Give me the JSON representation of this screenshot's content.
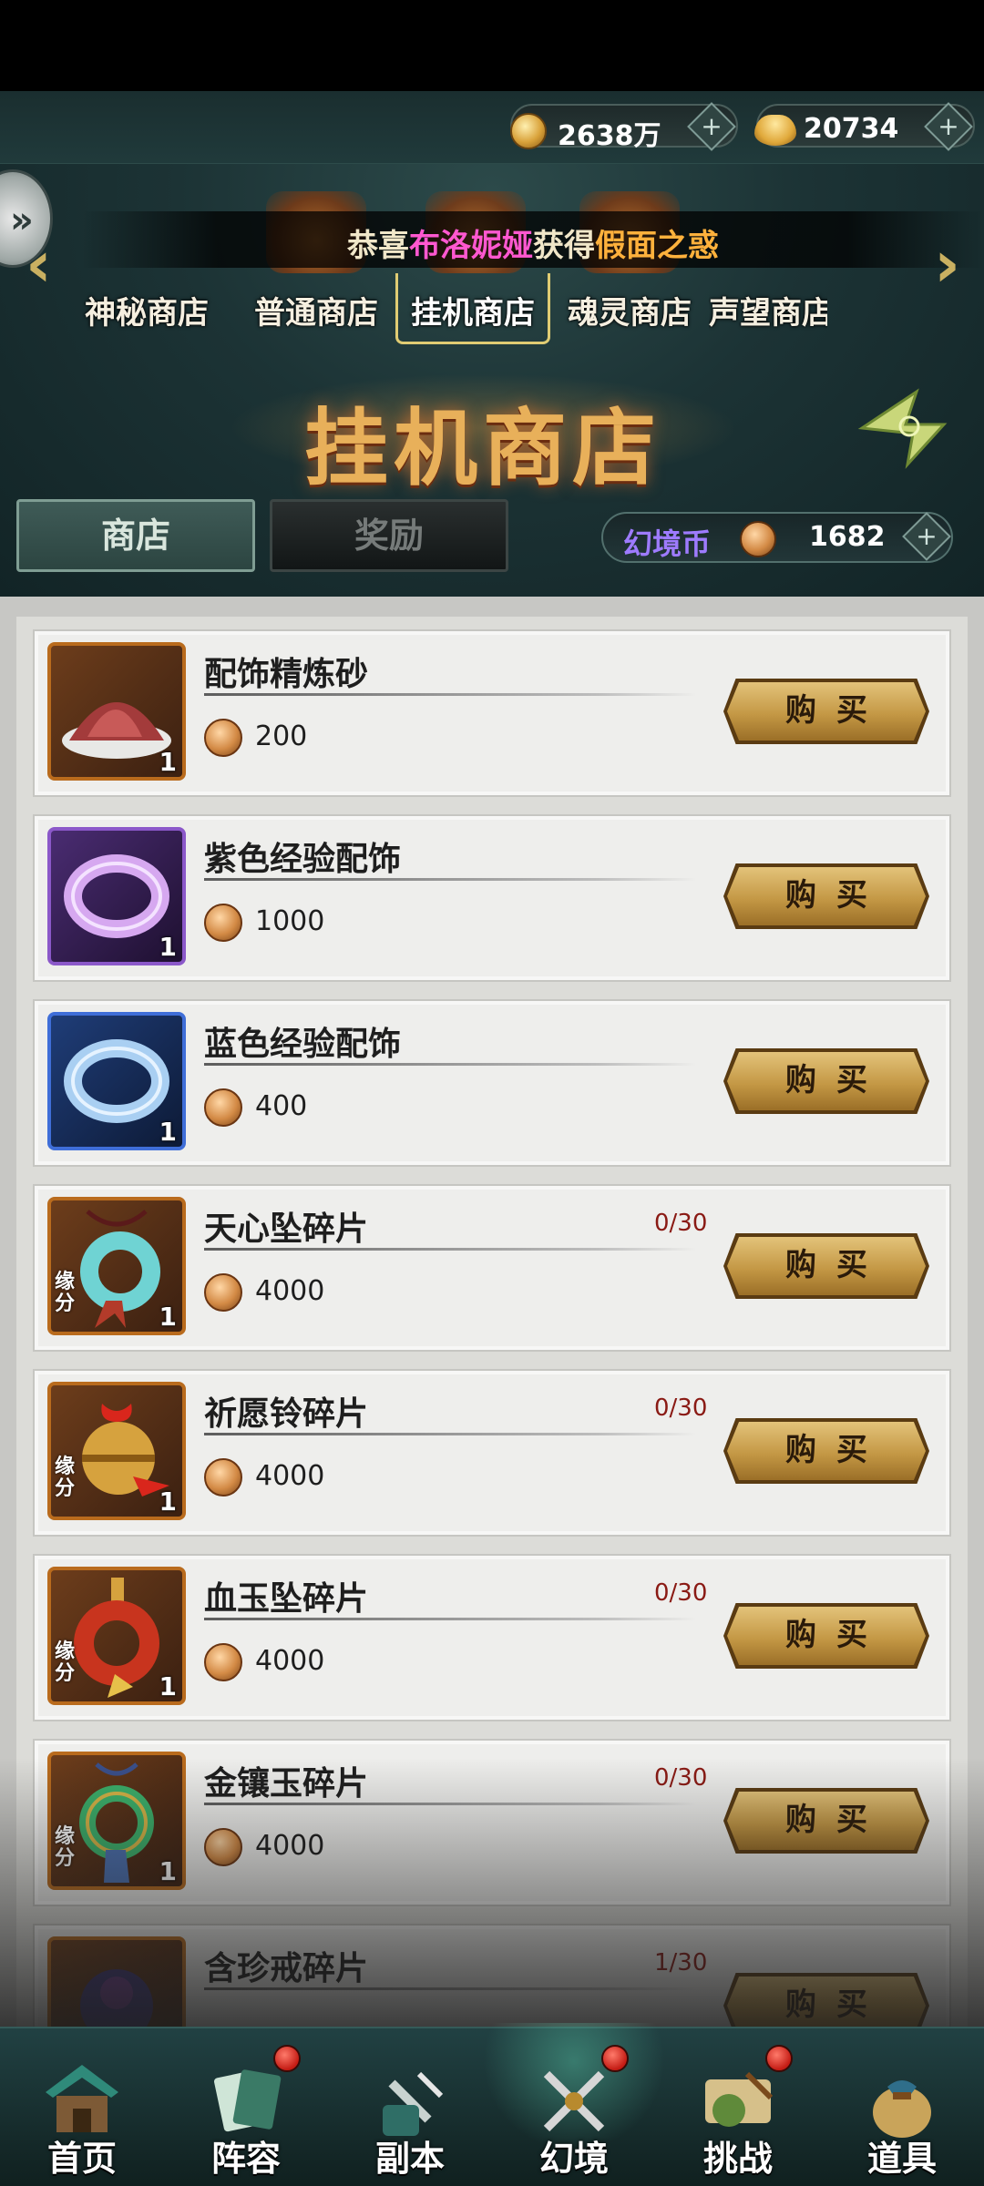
{
  "resources": {
    "gold": {
      "value": "2638万",
      "icon": "coin-icon"
    },
    "ingot": {
      "value": "20734",
      "icon": "ingot-icon"
    },
    "plus": "+"
  },
  "announcement": {
    "prefix": "恭喜",
    "player": "布洛妮娅",
    "middle": "获得",
    "item": "假面之惑"
  },
  "shop_tabs": [
    {
      "label": "神秘商店"
    },
    {
      "label": "普通商店"
    },
    {
      "label": "挂机商店"
    },
    {
      "label": "魂灵商店"
    },
    {
      "label": "声望商店"
    }
  ],
  "active_shop_index": 2,
  "page_title": "挂机商店",
  "tabs": {
    "store": "商店",
    "reward": "奖励"
  },
  "currency": {
    "label": "幻境币",
    "value": "1682",
    "plus": "+"
  },
  "buy_label": "购买",
  "items": [
    {
      "name": "配饰精炼砂",
      "price": "200",
      "qty": "1",
      "limit": "",
      "tag": "",
      "frame": "orange",
      "icon": "sand-icon"
    },
    {
      "name": "紫色经验配饰",
      "price": "1000",
      "qty": "1",
      "limit": "",
      "tag": "",
      "frame": "purple",
      "icon": "purple-bracelet-icon"
    },
    {
      "name": "蓝色经验配饰",
      "price": "400",
      "qty": "1",
      "limit": "",
      "tag": "",
      "frame": "blue",
      "icon": "blue-bracelet-icon"
    },
    {
      "name": "天心坠碎片",
      "price": "4000",
      "qty": "1",
      "limit": "0/30",
      "tag": "缘分",
      "frame": "orange",
      "icon": "pendant-icon"
    },
    {
      "name": "祈愿铃碎片",
      "price": "4000",
      "qty": "1",
      "limit": "0/30",
      "tag": "缘分",
      "frame": "orange",
      "icon": "bell-icon"
    },
    {
      "name": "血玉坠碎片",
      "price": "4000",
      "qty": "1",
      "limit": "0/30",
      "tag": "缘分",
      "frame": "orange",
      "icon": "blood-jade-icon"
    },
    {
      "name": "金镶玉碎片",
      "price": "4000",
      "qty": "1",
      "limit": "0/30",
      "tag": "缘分",
      "frame": "orange",
      "icon": "gold-jade-icon"
    },
    {
      "name": "含珍戒碎片",
      "price": "",
      "qty": "",
      "limit": "1/30",
      "tag": "",
      "frame": "orange",
      "icon": "ring-icon"
    }
  ],
  "nav": [
    {
      "label": "首页",
      "icon": "home-icon",
      "badge": false
    },
    {
      "label": "阵容",
      "icon": "lineup-icon",
      "badge": true
    },
    {
      "label": "副本",
      "icon": "dungeon-icon",
      "badge": false
    },
    {
      "label": "幻境",
      "icon": "illusion-icon",
      "badge": true
    },
    {
      "label": "挑战",
      "icon": "challenge-icon",
      "badge": true
    },
    {
      "label": "道具",
      "icon": "items-icon",
      "badge": false
    }
  ],
  "active_nav_index": 3
}
